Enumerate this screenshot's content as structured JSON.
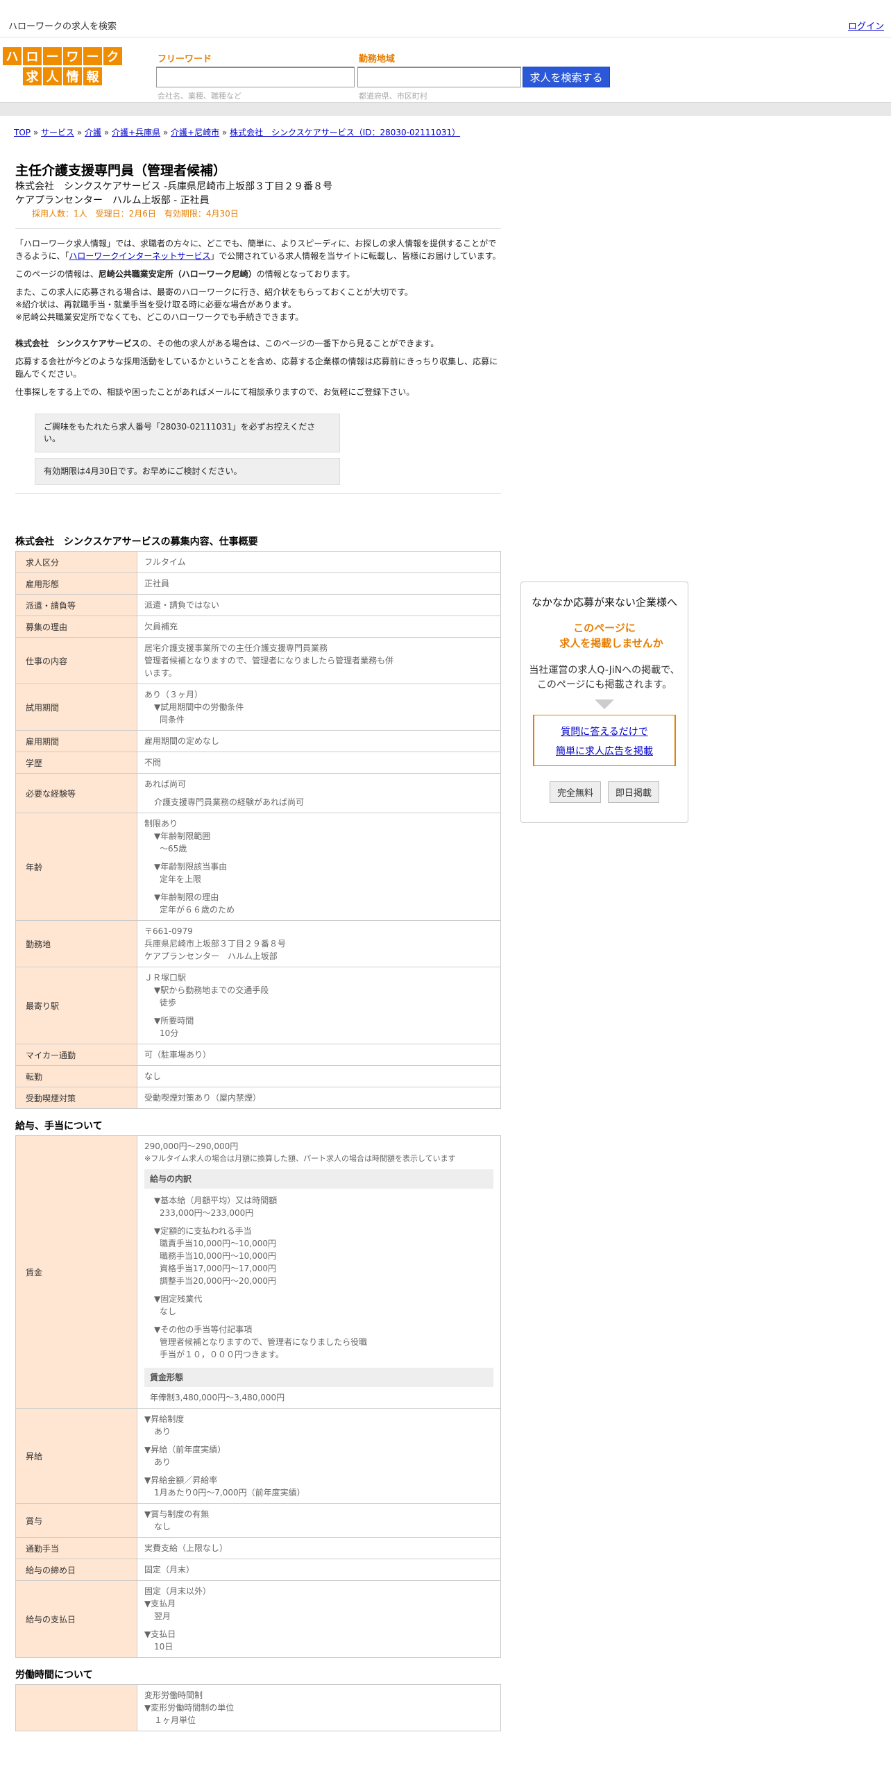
{
  "header": {
    "tagline": "ハローワークの求人を検索",
    "login": "ログイン"
  },
  "logo": {
    "row1": [
      "ハ",
      "ロ",
      "ー",
      "ワ",
      "ー",
      "ク"
    ],
    "row2": [
      "求",
      "人",
      "情",
      "報"
    ],
    "color": "#f08c00"
  },
  "search": {
    "freeword_label": "フリーワード",
    "freeword_hint": "会社名、業種、職種など",
    "area_label": "勤務地域",
    "area_hint": "都道府県、市区町村",
    "button": "求人を検索する",
    "button_color": "#2a58d8"
  },
  "breadcrumb": [
    {
      "text": "TOP"
    },
    {
      "text": "サービス"
    },
    {
      "text": "介護"
    },
    {
      "text": "介護+兵庫県"
    },
    {
      "text": "介護+尼崎市"
    },
    {
      "text": "株式会社　シンクスケアサービス（ID：28030-02111031）"
    }
  ],
  "job": {
    "title": "主任介護支援専門員（管理者候補）",
    "company_line": "株式会社　シンクスケアサービス -兵庫県尼崎市上坂部３丁目２９番８号",
    "office_line": "ケアプランセンター　ハルム上坂部 - 正社員",
    "meta": "採用人数：1人　受理日：2月6日　有効期限：4月30日"
  },
  "intro": {
    "p1a": "「ハローワーク求人情報」では、求職者の方々に、どこでも、簡単に、よりスピーディに、お探しの求人情報を提供することができるように、「",
    "p1link": "ハローワークインターネットサービス",
    "p1b": "」で公開されている求人情報を当サイトに転載し、皆様にお届けしています。",
    "p2a": "このページの情報は、",
    "p2b": "尼崎公共職業安定所（ハローワーク尼崎）",
    "p2c": "の情報となっております。",
    "p3": "また、この求人に応募される場合は、最寄のハローワークに行き、紹介状をもらっておくことが大切です。",
    "p4": "※紹介状は、再就職手当・就業手当を受け取る時に必要な場合があります。",
    "p5": "※尼崎公共職業安定所でなくても、どこのハローワークでも手続きできます。",
    "p6a": "株式会社　シンクスケアサービス",
    "p6b": "の、その他の求人がある場合は、このページの一番下から見ることができます。",
    "p7": "応募する会社が今どのような採用活動をしているかということを含め、応募する企業様の情報は応募前にきっちり収集し、応募に臨んでください。",
    "p8": "仕事探しをする上での、相談や困ったことがあればメールにて相談承りますので、お気軽にご登録下さい。",
    "box1": "ご興味をもたれたら求人番号「28030-02111031」を必ずお控えください。",
    "box2": "有効期限は4月30日です。お早めにご検討ください。"
  },
  "overview": {
    "heading": "株式会社　シンクスケアサービスの募集内容、仕事概要",
    "rows": [
      {
        "k": "求人区分",
        "v": "フルタイム"
      },
      {
        "k": "雇用形態",
        "v": "正社員"
      },
      {
        "k": "派遣・請負等",
        "v": "派遣・請負ではない"
      },
      {
        "k": "募集の理由",
        "v": "欠員補充"
      },
      {
        "k": "仕事の内容",
        "v": "居宅介護支援事業所での主任介護支援専門員業務\n管理者候補となりますので、管理者になりましたら管理者業務も併\nいます。"
      },
      {
        "k": "試用期間",
        "v": "あり（３ヶ月）"
      },
      {
        "k": "雇用期間",
        "v": "雇用期間の定めなし"
      },
      {
        "k": "学歴",
        "v": "不問"
      },
      {
        "k": "必要な経験等",
        "v": "あれば尚可"
      },
      {
        "k": "年齢",
        "v": "制限あり"
      },
      {
        "k": "勤務地",
        "v": "〒661-0979\n兵庫県尼崎市上坂部３丁目２９番８号\nケアプランセンター　ハルム上坂部"
      },
      {
        "k": "最寄り駅",
        "v": "ＪＲ塚口駅"
      },
      {
        "k": "マイカー通勤",
        "v": "可（駐車場あり）"
      },
      {
        "k": "転勤",
        "v": "なし"
      },
      {
        "k": "受動喫煙対策",
        "v": "受動喫煙対策あり（屋内禁煙）"
      }
    ],
    "trial": {
      "h": "▼試用期間中の労働条件",
      "v": "同条件"
    },
    "exp": {
      "v": "介護支援専門員業務の経験があれば尚可"
    },
    "age": [
      {
        "h": "▼年齢制限範囲",
        "v": "〜65歳"
      },
      {
        "h": "▼年齢制限該当事由",
        "v": "定年を上限"
      },
      {
        "h": "▼年齢制限の理由",
        "v": "定年が６６歳のため"
      }
    ],
    "station": [
      {
        "h": "▼駅から勤務地までの交通手段",
        "v": "徒歩"
      },
      {
        "h": "▼所要時間",
        "v": "10分"
      }
    ]
  },
  "salary": {
    "heading": "給与、手当について",
    "wage_label": "賃金",
    "range": "290,000円〜290,000円",
    "note": "※フルタイム求人の場合は月額に換算した額、パート求人の場合は時間額を表示しています",
    "breakdown_h": "給与の内訳",
    "base_h": "▼基本給（月額平均）又は時間額",
    "base_v": "233,000円〜233,000円",
    "fixed_h": "▼定額的に支払われる手当",
    "fixed_v": [
      "職責手当10,000円〜10,000円",
      "職務手当10,000円〜10,000円",
      "資格手当17,000円〜17,000円",
      "調整手当20,000円〜20,000円"
    ],
    "ot_h": "▼固定残業代",
    "ot_v": "なし",
    "other_h": "▼その他の手当等付記事項",
    "other_v": [
      "管理者候補となりますので、管理者になりましたら役職",
      "手当が１０，０００円つきます。"
    ],
    "form_h": "賃金形態",
    "form_v": "年俸制3,480,000円〜3,480,000円",
    "raise_label": "昇給",
    "raise": [
      {
        "h": "▼昇給制度",
        "v": "あり"
      },
      {
        "h": "▼昇給（前年度実績）",
        "v": "あり"
      },
      {
        "h": "▼昇給金額／昇給率",
        "v": "1月あたり0円〜7,000円（前年度実績）"
      }
    ],
    "bonus_label": "賞与",
    "bonus_h": "▼賞与制度の有無",
    "bonus_v": "なし",
    "commute_label": "通勤手当",
    "commute_v": "実費支給（上限なし）",
    "close_label": "給与の締め日",
    "close_v": "固定（月末）",
    "pay_label": "給与の支払日",
    "pay_v": "固定（月末以外）",
    "pay": [
      {
        "h": "▼支払月",
        "v": "翌月"
      },
      {
        "h": "▼支払日",
        "v": "10日"
      }
    ]
  },
  "hours": {
    "heading": "労働時間について",
    "v1": "変形労働時間制",
    "h2": "▼変形労働時間制の単位",
    "v2": "１ヶ月単位"
  },
  "side": {
    "t1": "なかなか応募が来ない企業様へ",
    "t2a": "このページに",
    "t2b": "求人を掲載しませんか",
    "t3a": "当社運営の求人Q-JiNへの掲載で、",
    "t3b": "このページにも掲載されます。",
    "link1": "質問に答えるだけで",
    "link2": "簡単に求人広告を掲載",
    "btn1": "完全無料",
    "btn2": "即日掲載"
  }
}
